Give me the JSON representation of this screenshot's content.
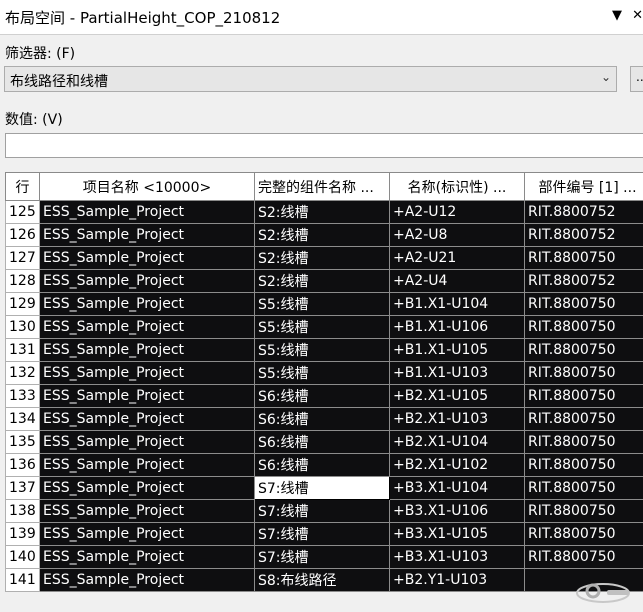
{
  "window": {
    "title": "布局空间 - PartialHeight_COP_210812",
    "controls": [
      "▼",
      "✕"
    ]
  },
  "filter": {
    "label": "筛选器: (F)",
    "value": "布线路径和线槽",
    "side_button_label": "..."
  },
  "value_field": {
    "label": "数值: (V)",
    "value": ""
  },
  "table": {
    "columns": [
      "行",
      "项目名称 <10000>",
      "完整的组件名称 ...",
      "名称(标识性) ...",
      "部件编号 [1] ..."
    ],
    "rows": [
      {
        "row": "125",
        "project": "ESS_Sample_Project",
        "component": "S2:线槽",
        "name": "+A2-U12",
        "part": "RIT.8800752"
      },
      {
        "row": "126",
        "project": "ESS_Sample_Project",
        "component": "S2:线槽",
        "name": "+A2-U8",
        "part": "RIT.8800752"
      },
      {
        "row": "127",
        "project": "ESS_Sample_Project",
        "component": "S2:线槽",
        "name": "+A2-U21",
        "part": "RIT.8800750"
      },
      {
        "row": "128",
        "project": "ESS_Sample_Project",
        "component": "S2:线槽",
        "name": "+A2-U4",
        "part": "RIT.8800752"
      },
      {
        "row": "129",
        "project": "ESS_Sample_Project",
        "component": "S5:线槽",
        "name": "+B1.X1-U104",
        "part": "RIT.8800750"
      },
      {
        "row": "130",
        "project": "ESS_Sample_Project",
        "component": "S5:线槽",
        "name": "+B1.X1-U106",
        "part": "RIT.8800750"
      },
      {
        "row": "131",
        "project": "ESS_Sample_Project",
        "component": "S5:线槽",
        "name": "+B1.X1-U105",
        "part": "RIT.8800750"
      },
      {
        "row": "132",
        "project": "ESS_Sample_Project",
        "component": "S5:线槽",
        "name": "+B1.X1-U103",
        "part": "RIT.8800750"
      },
      {
        "row": "133",
        "project": "ESS_Sample_Project",
        "component": "S6:线槽",
        "name": "+B2.X1-U105",
        "part": "RIT.8800750"
      },
      {
        "row": "134",
        "project": "ESS_Sample_Project",
        "component": "S6:线槽",
        "name": "+B2.X1-U103",
        "part": "RIT.8800750"
      },
      {
        "row": "135",
        "project": "ESS_Sample_Project",
        "component": "S6:线槽",
        "name": "+B2.X1-U104",
        "part": "RIT.8800750"
      },
      {
        "row": "136",
        "project": "ESS_Sample_Project",
        "component": "S6:线槽",
        "name": "+B2.X1-U102",
        "part": "RIT.8800750"
      },
      {
        "row": "137",
        "project": "ESS_Sample_Project",
        "component": "S7:线槽",
        "name": "+B3.X1-U104",
        "part": "RIT.8800750",
        "selected": true
      },
      {
        "row": "138",
        "project": "ESS_Sample_Project",
        "component": "S7:线槽",
        "name": "+B3.X1-U106",
        "part": "RIT.8800750"
      },
      {
        "row": "139",
        "project": "ESS_Sample_Project",
        "component": "S7:线槽",
        "name": "+B3.X1-U105",
        "part": "RIT.8800750"
      },
      {
        "row": "140",
        "project": "ESS_Sample_Project",
        "component": "S7:线槽",
        "name": "+B3.X1-U103",
        "part": "RIT.8800750"
      },
      {
        "row": "141",
        "project": "ESS_Sample_Project",
        "component": "S8:布线路径",
        "name": "+B2.Y1-U103",
        "part": ""
      }
    ]
  },
  "colors": {
    "cell_bg": "#0e0e10",
    "cell_text": "#ffffff",
    "header_bg": "#ffffff",
    "window_bg": "#f0f0f0"
  }
}
